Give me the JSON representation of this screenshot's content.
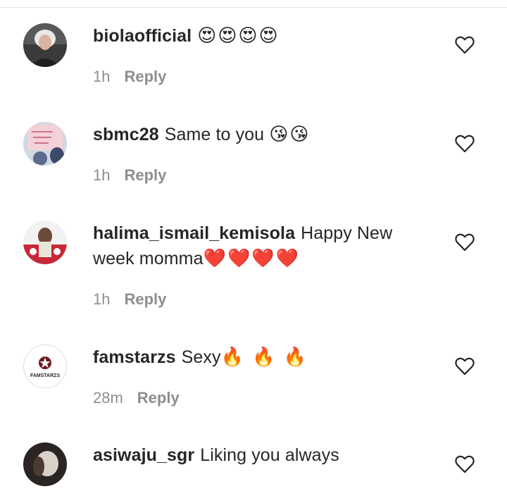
{
  "comments": [
    {
      "username": "biolaofficial",
      "text": "",
      "emoji": "😍😍😍😍",
      "time": "1h",
      "reply_label": "Reply",
      "avatar_icon": "user-avatar-photo"
    },
    {
      "username": "sbmc28",
      "text": "Same to you",
      "emoji": "😘😘",
      "time": "1h",
      "reply_label": "Reply",
      "avatar_icon": "user-avatar-photo"
    },
    {
      "username": "halima_ismail_kemisola",
      "text": "Happy New week momma",
      "emoji": "❤️❤️❤️❤️",
      "time": "1h",
      "reply_label": "Reply",
      "avatar_icon": "user-avatar-photo"
    },
    {
      "username": "famstarzs",
      "text": "Sexy",
      "emoji": "🔥 🔥 🔥",
      "time": "28m",
      "reply_label": "Reply",
      "avatar_icon": "famstarzs-logo",
      "avatar_text": "FAMSTARZS"
    },
    {
      "username": "asiwaju_sgr",
      "text": "Liking you always",
      "emoji": "",
      "time": "",
      "reply_label": "",
      "avatar_icon": "user-avatar-photo"
    }
  ],
  "colors": {
    "text": "#262626",
    "meta": "#8e8e8e",
    "divider": "#e6e6e6",
    "heart_emoji": "#e0245e"
  }
}
